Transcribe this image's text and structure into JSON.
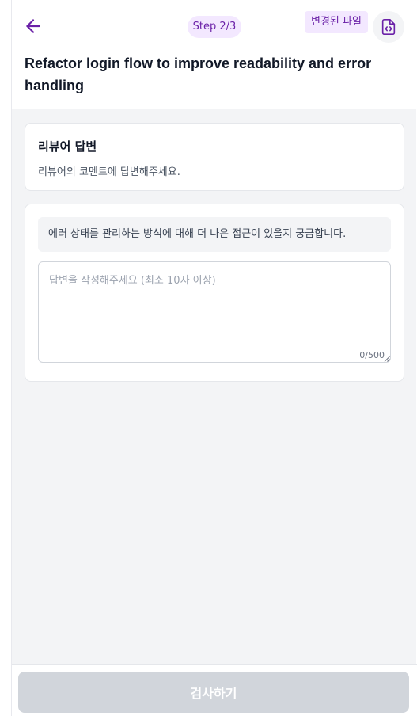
{
  "header": {
    "back_icon": "arrow-left-icon",
    "step_label": "Step 2/3",
    "changed_files_label": "변경된 파일",
    "file_code_icon": "file-code-icon",
    "title": "Refactor login flow to improve readability and error handling",
    "accent_color": "#6b21a8",
    "pill_background": "#f3e8ff"
  },
  "intro": {
    "heading": "리뷰어 답변",
    "description": "리뷰어의 코멘트에 답변해주세요."
  },
  "reply": {
    "reviewer_comment": "에러 상태를 관리하는 방식에 대해 더 나은 접근이 있을지 궁금합니다.",
    "input_value": "",
    "input_placeholder": "답변을 작성해주세요 (최소 10자 이상)",
    "char_count": "0/500"
  },
  "footer": {
    "submit_label": "검사하기",
    "submit_disabled": true
  }
}
